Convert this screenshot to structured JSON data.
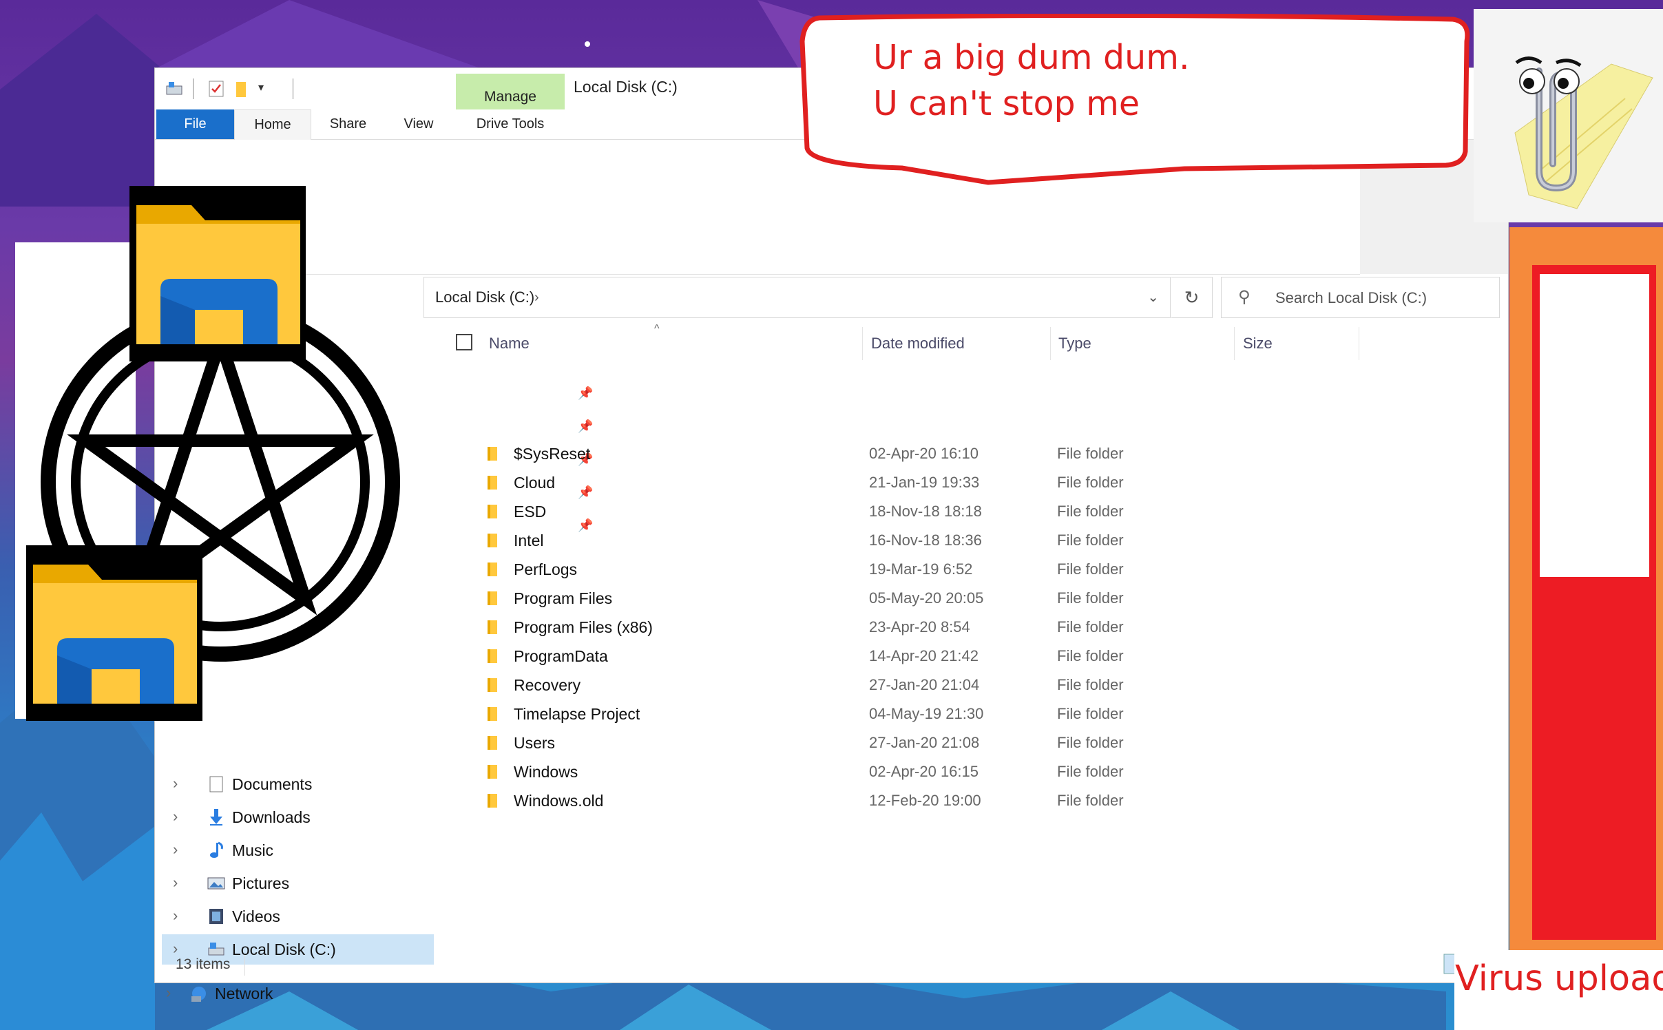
{
  "window": {
    "title": "Local Disk (C:)",
    "manage_tab": "Manage",
    "tabs": [
      {
        "label": "File"
      },
      {
        "label": "Home"
      },
      {
        "label": "Share"
      },
      {
        "label": "View"
      },
      {
        "label": "Drive Tools"
      }
    ]
  },
  "address_bar": {
    "path": "Local Disk (C:)",
    "chevron": "›",
    "dropdown": "⌄",
    "refresh": "↻"
  },
  "search": {
    "placeholder": "Search Local Disk (C:)"
  },
  "columns": {
    "name": "Name",
    "date": "Date modified",
    "type": "Type",
    "size": "Size"
  },
  "files": [
    {
      "name": "$SysReset",
      "date": "02-Apr-20 16:10",
      "type": "File folder"
    },
    {
      "name": "Cloud",
      "date": "21-Jan-19 19:33",
      "type": "File folder"
    },
    {
      "name": "ESD",
      "date": "18-Nov-18 18:18",
      "type": "File folder"
    },
    {
      "name": "Intel",
      "date": "16-Nov-18 18:36",
      "type": "File folder"
    },
    {
      "name": "PerfLogs",
      "date": "19-Mar-19 6:52",
      "type": "File folder"
    },
    {
      "name": "Program Files",
      "date": "05-May-20 20:05",
      "type": "File folder"
    },
    {
      "name": "Program Files (x86)",
      "date": "23-Apr-20 8:54",
      "type": "File folder"
    },
    {
      "name": "ProgramData",
      "date": "14-Apr-20 21:42",
      "type": "File folder"
    },
    {
      "name": "Recovery",
      "date": "27-Jan-20 21:04",
      "type": "File folder"
    },
    {
      "name": "Timelapse Project",
      "date": "04-May-19 21:30",
      "type": "File folder"
    },
    {
      "name": "Users",
      "date": "27-Jan-20 21:08",
      "type": "File folder"
    },
    {
      "name": "Windows",
      "date": "02-Apr-20 16:15",
      "type": "File folder"
    },
    {
      "name": "Windows.old",
      "date": "12-Feb-20 19:00",
      "type": "File folder"
    }
  ],
  "sidebar": {
    "items": [
      {
        "label": "Documents",
        "icon": "documents-icon"
      },
      {
        "label": "Downloads",
        "icon": "downloads-icon"
      },
      {
        "label": "Music",
        "icon": "music-icon"
      },
      {
        "label": "Pictures",
        "icon": "pictures-icon"
      },
      {
        "label": "Videos",
        "icon": "videos-icon"
      },
      {
        "label": "Local Disk (C:)",
        "icon": "drive-icon",
        "selected": true
      },
      {
        "label": "Network",
        "icon": "network-icon"
      }
    ]
  },
  "status": {
    "count": "13 items"
  },
  "overlay": {
    "bubble_line1": "Ur a big dum dum.",
    "bubble_line2": "U can't stop me",
    "virus_label": "Virus upload",
    "colors": {
      "red": "#ED1C24",
      "folder_yellow": "#FFC83D",
      "folder_blue": "#1A6FCB",
      "selection": "#CCE4F7",
      "manage_green": "#C7ECAB"
    }
  }
}
